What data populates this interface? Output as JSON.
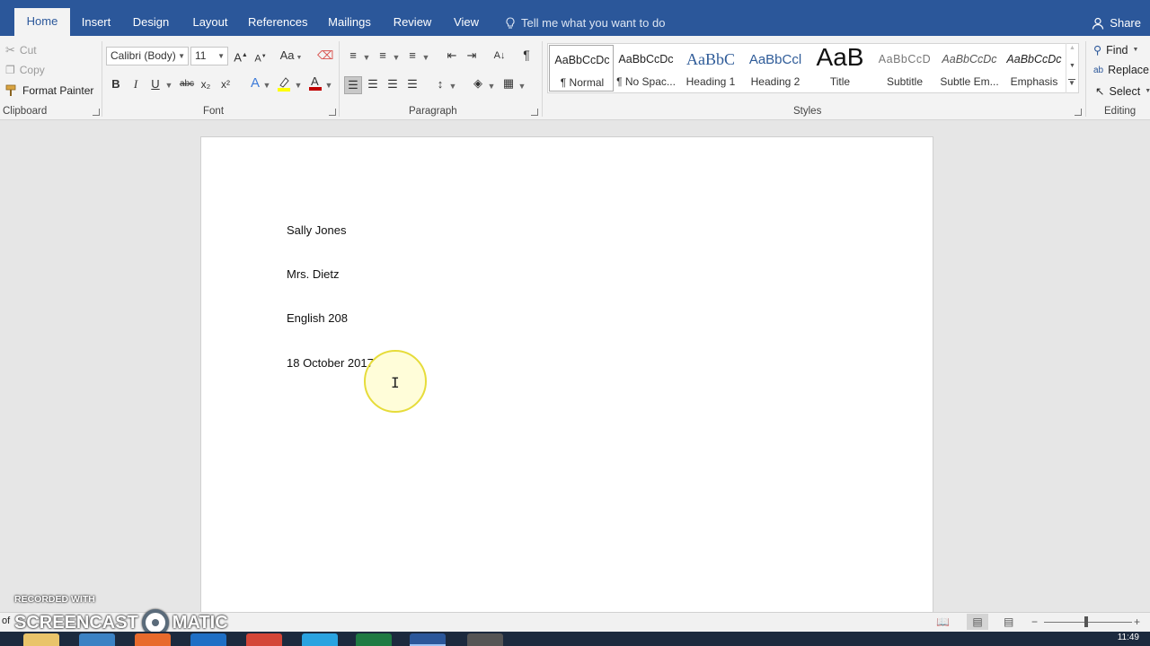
{
  "tabs": [
    {
      "label": "Home",
      "active": true
    },
    {
      "label": "Insert"
    },
    {
      "label": "Design"
    },
    {
      "label": "Layout"
    },
    {
      "label": "References"
    },
    {
      "label": "Mailings"
    },
    {
      "label": "Review"
    },
    {
      "label": "View"
    }
  ],
  "tell_me": {
    "placeholder": "Tell me what you want to do",
    "icon": "lightbulb-icon"
  },
  "share": {
    "label": "Share",
    "icon": "person-icon"
  },
  "clipboard": {
    "cut": "Cut",
    "copy": "Copy",
    "format_painter": "Format Painter",
    "group_label": "Clipboard"
  },
  "font": {
    "family": "Calibri (Body)",
    "size": "11",
    "case_label": "Aa",
    "bold": "B",
    "italic": "I",
    "underline": "U",
    "strike": "abc",
    "subscript": "x₂",
    "superscript": "x²",
    "group_label": "Font",
    "font_color": "#c00000",
    "highlight_color": "#ffff00"
  },
  "paragraph": {
    "group_label": "Paragraph",
    "show_marks": "¶"
  },
  "styles": {
    "group_label": "Styles",
    "items": [
      {
        "sample": "AaBbCcDc",
        "name": "¶ Normal",
        "selected": true
      },
      {
        "sample": "AaBbCcDc",
        "name": "¶ No Spac..."
      },
      {
        "sample": "AaBbC",
        "name": "Heading 1"
      },
      {
        "sample": "AaBbCcl",
        "name": "Heading 2"
      },
      {
        "sample": "AaB",
        "name": "Title"
      },
      {
        "sample": "AaBbCcD",
        "name": "Subtitle"
      },
      {
        "sample": "AaBbCcDc",
        "name": "Subtle Em..."
      },
      {
        "sample": "AaBbCcDc",
        "name": "Emphasis"
      }
    ]
  },
  "editing": {
    "find": "Find",
    "replace": "Replace",
    "select": "Select",
    "group_label": "Editing"
  },
  "document": {
    "lines": [
      "Sally Jones",
      "Mrs. Dietz",
      "English 208",
      "18 October 2017"
    ]
  },
  "watermark": {
    "top": "RECORDED WITH",
    "left": "SCREENCAST",
    "right": "MATIC",
    "prefix": "of"
  },
  "clock": "11:49",
  "colors": {
    "accent": "#2b579a",
    "ribbon": "#f3f3f3",
    "workspace": "#e6e6e6"
  }
}
